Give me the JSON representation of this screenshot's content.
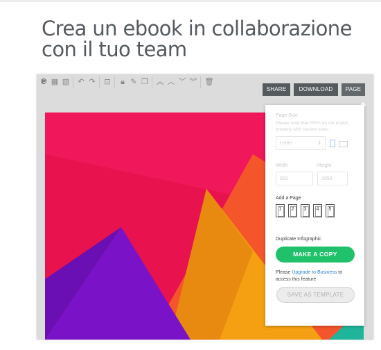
{
  "headline": "Crea un ebook in collaborazione con il tuo team",
  "toolbar": {
    "icons": [
      "logo-icon",
      "image-icon",
      "photo-icon",
      "undo-icon",
      "redo-icon",
      "crop-icon",
      "lock-icon",
      "edit-icon",
      "copy-icon",
      "move-top-icon",
      "move-up-icon",
      "move-down-icon",
      "move-bottom-icon",
      "trash-icon"
    ],
    "share_label": "SHARE",
    "download_label": "DOWNLOAD",
    "page_label": "PAGE"
  },
  "page_panel": {
    "page_size_label": "Page Size",
    "page_size_note": "Please note that PDFs do not export properly with custom sizes.",
    "size_select": "Letter",
    "width_label": "Width",
    "height_label": "Height",
    "width_value": "816",
    "height_value": "1056",
    "add_page_label": "Add a Page",
    "page_numbers": [
      "1",
      "2",
      "3",
      "4",
      "5"
    ],
    "duplicate_label": "Duplicate Infographic",
    "make_copy_label": "MAKE A COPY",
    "upgrade_prefix": "Please ",
    "upgrade_link": "Upgrade to Business",
    "upgrade_suffix": " to access this feature",
    "save_template_label": "SAVE AS TEMPLATE"
  },
  "colors": {
    "canvas_bg": "#f0175a",
    "triangle_purple": "#7a12c8",
    "triangle_orange": "#f5a012",
    "triangle_red": "#f5552a",
    "accent_green": "#1fc16a",
    "toolbar_button": "#555a5e"
  }
}
